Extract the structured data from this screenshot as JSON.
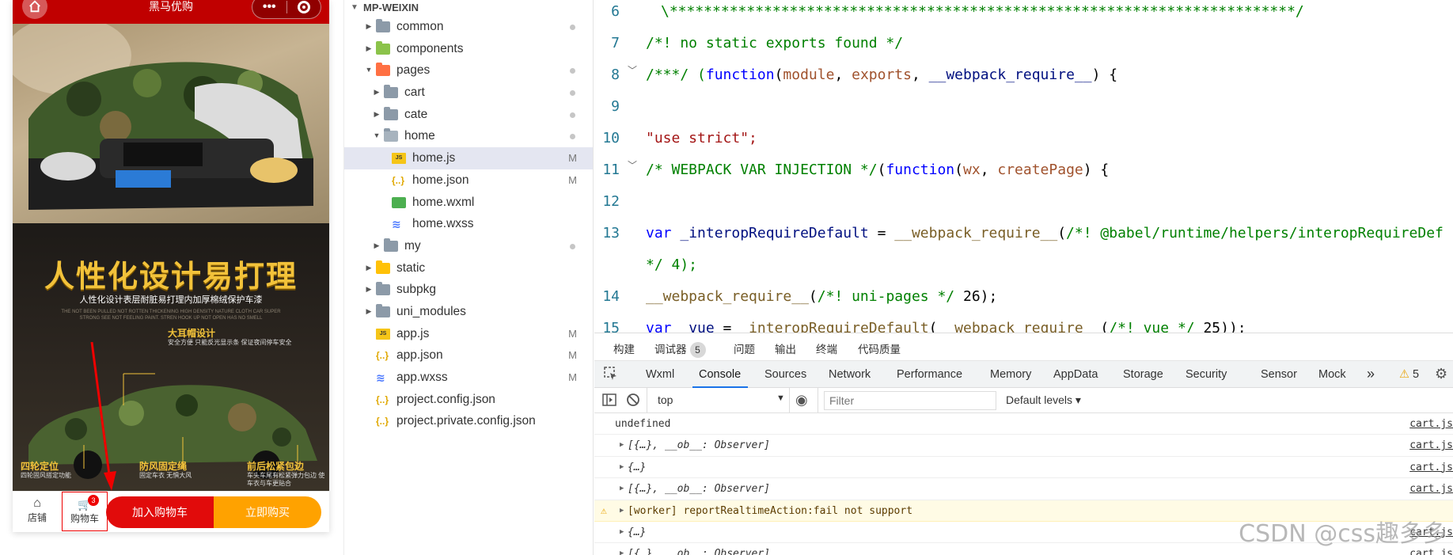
{
  "simulator": {
    "nav_title": "黑马优购",
    "capsule_more": "•••",
    "promo_title": "人性化设计易打理",
    "promo_subtitle": "人性化设计表层耐脏易打理内加厚棉绒保护车漆",
    "promo_small": "THE NOT BEEN PULLED NOT ROTTEN THICKENING HIGH DENSITY NATURE CLOTH CAR SUPER STRONG SEE NOT FEELING PAINT. STREN HOOK UP NOT OPEN HAS NO SMELL",
    "features": [
      {
        "title": "大耳帽设计",
        "desc": "安全方便 只能反光显示条 保证夜间停车安全"
      },
      {
        "title": "四轮定位",
        "desc": "四轮固风搭定功能"
      },
      {
        "title": "防风固定绳",
        "desc": "固定车衣 无惧大风"
      },
      {
        "title": "前后松紧包边",
        "desc": "车头车尾有松紧弹力包边 使车衣与车更贴合"
      }
    ],
    "tabbar": {
      "shop_label": "店铺",
      "cart_label": "购物车",
      "cart_badge": "3",
      "add_cart_label": "加入购物车",
      "buy_now_label": "立即购买"
    },
    "colors": {
      "nav": "#c00000",
      "add_cart": "#e10b0b",
      "buy_now": "#ffa200"
    }
  },
  "explorer": {
    "root": "MP-WEIXIN",
    "items": [
      {
        "label": "common",
        "status": "dot"
      },
      {
        "label": "components",
        "status": ""
      },
      {
        "label": "pages",
        "status": "dot"
      },
      {
        "label": "cart",
        "status": "dot"
      },
      {
        "label": "cate",
        "status": "dot"
      },
      {
        "label": "home",
        "status": "dot"
      },
      {
        "label": "home.js",
        "status": "M"
      },
      {
        "label": "home.json",
        "status": "M"
      },
      {
        "label": "home.wxml",
        "status": ""
      },
      {
        "label": "home.wxss",
        "status": ""
      },
      {
        "label": "my",
        "status": "dot"
      },
      {
        "label": "static",
        "status": ""
      },
      {
        "label": "subpkg",
        "status": ""
      },
      {
        "label": "uni_modules",
        "status": ""
      },
      {
        "label": "app.js",
        "status": "M"
      },
      {
        "label": "app.json",
        "status": "M"
      },
      {
        "label": "app.wxss",
        "status": "M"
      },
      {
        "label": "project.config.json",
        "status": ""
      },
      {
        "label": "project.private.config.json",
        "status": ""
      }
    ]
  },
  "editor": {
    "lines": [
      {
        "num": "6",
        "text": "\\*************************************************************************/"
      },
      {
        "num": "7",
        "text": "/*! no static exports found */"
      },
      {
        "num": "8",
        "p1": "/***/ (",
        "p2": "function",
        "p3": "(",
        "p4": "module",
        "p5": ", ",
        "p6": "exports",
        "p7": ", ",
        "p8": "__webpack_require__",
        "p9": ") {"
      },
      {
        "num": "9",
        "text": ""
      },
      {
        "num": "10",
        "text": "\"use strict\";"
      },
      {
        "num": "11",
        "p1": "/* WEBPACK VAR INJECTION */",
        "p2": "(",
        "p3": "function",
        "p4": "(",
        "p5": "wx",
        "p6": ", ",
        "p7": "createPage",
        "p8": ") {"
      },
      {
        "num": "12",
        "text": ""
      },
      {
        "num": "13",
        "p1": "var ",
        "p2": "_interopRequireDefault",
        "p3": " = ",
        "p4": "__webpack_require__",
        "p5": "(",
        "p6": "/*! @babel/runtime/helpers/interopRequireDef"
      },
      {
        "num": "",
        "text": "*/ 4);"
      },
      {
        "num": "14",
        "p1": "__webpack_require__",
        "p2": "(",
        "p3": "/*! uni-pages */",
        "p4": " 26);"
      },
      {
        "num": "15",
        "p1": "var ",
        "p2": "_vue",
        "p3": " = ",
        "p4": "_interopRequireDefault",
        "p5": "(",
        "p6": "__webpack_require__",
        "p7": "(",
        "p8": "/*! vue */",
        "p9": " 25));"
      }
    ]
  },
  "devtools": {
    "top_tabs": [
      "构建",
      "调试器",
      "问题",
      "输出",
      "终端",
      "代码质量"
    ],
    "debugger_count": "5",
    "panel_tabs": [
      "Wxml",
      "Console",
      "Sources",
      "Network",
      "Performance",
      "Memory",
      "AppData",
      "Storage",
      "Security",
      "Sensor",
      "Mock"
    ],
    "more": "»",
    "warn_count": "5",
    "context": "top",
    "filter_placeholder": "Filter",
    "levels": "Default levels ▾",
    "console": [
      {
        "text": "undefined",
        "src": "cart.js",
        "kind": "plain"
      },
      {
        "text": "[{…}, __ob__: Observer]",
        "src": "cart.js",
        "kind": "obj"
      },
      {
        "text": "{…}",
        "src": "cart.js",
        "kind": "obj"
      },
      {
        "text": "[{…}, __ob__: Observer]",
        "src": "cart.js",
        "kind": "obj"
      },
      {
        "text": "[worker] reportRealtimeAction:fail not support",
        "src": "",
        "kind": "warn"
      },
      {
        "text": "{…}",
        "src": "cart.js",
        "kind": "obj"
      },
      {
        "text": "[{…}, __ob__: Observer]",
        "src": "cart.js",
        "kind": "obj"
      }
    ],
    "watermark": "CSDN @css趣多多"
  }
}
